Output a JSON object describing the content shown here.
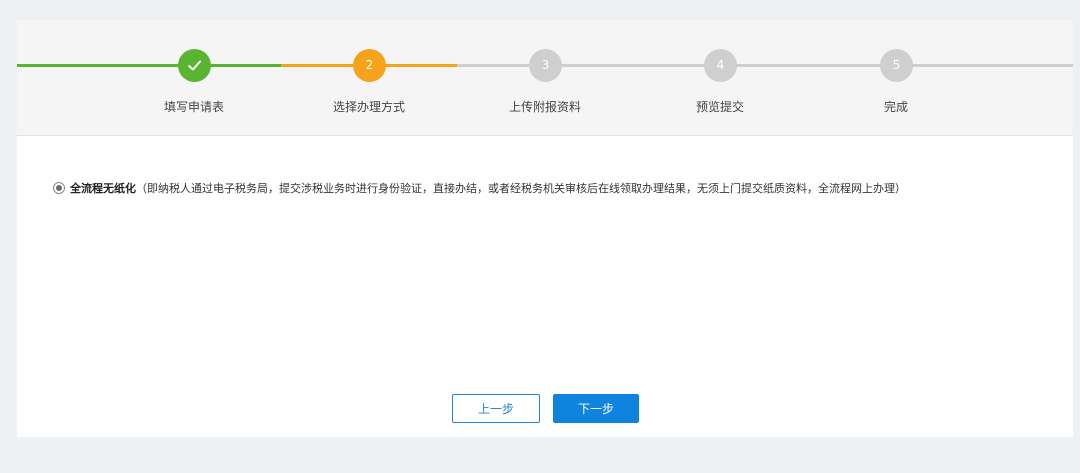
{
  "steps": [
    {
      "number": "",
      "label": "填写申请表",
      "status": "done",
      "icon": "check-icon"
    },
    {
      "number": "2",
      "label": "选择办理方式",
      "status": "active"
    },
    {
      "number": "3",
      "label": "上传附报资料",
      "status": "pending"
    },
    {
      "number": "4",
      "label": "预览提交",
      "status": "pending"
    },
    {
      "number": "5",
      "label": "完成",
      "status": "pending"
    }
  ],
  "colors": {
    "done": "#58b431",
    "active": "#f7a21b",
    "pending": "#cfcfcf",
    "primary_button": "#0f84de"
  },
  "option": {
    "title": "全流程无纸化",
    "description": "（即纳税人通过电子税务局，提交涉税业务时进行身份验证，直接办结，或者经税务机关审核后在线领取办理结果，无须上门提交纸质资料，全流程网上办理）",
    "selected": true
  },
  "buttons": {
    "prev_label": "上一步",
    "next_label": "下一步"
  }
}
